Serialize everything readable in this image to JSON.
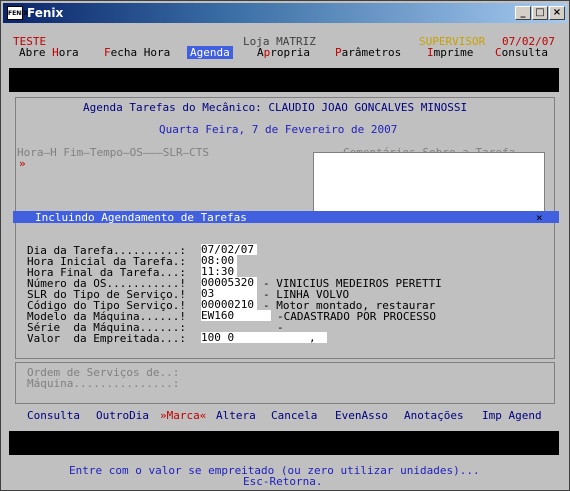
{
  "window": {
    "title": "Fenix",
    "icon_text": "FENIX"
  },
  "header": {
    "left": "TESTE",
    "center": "Loja MATRIZ",
    "user": "SUPERVISOR",
    "date": "07/02/07"
  },
  "menu": {
    "items": [
      {
        "first": "Abre ",
        "hot": "H",
        "rest": "ora"
      },
      {
        "first": "",
        "hot": "F",
        "rest": "echa Hora"
      },
      {
        "label": "Agenda"
      },
      {
        "first": "A",
        "hot": "p",
        "rest": "ropria"
      },
      {
        "first": "",
        "hot": "P",
        "rest": "arâmetros"
      },
      {
        "first": "",
        "hot": "I",
        "rest": "mprime"
      },
      {
        "first": "",
        "hot": "C",
        "rest": "onsulta"
      }
    ]
  },
  "agenda": {
    "heading": "Agenda Tarefas do Mecânico: CLAUDIO JOAO GONCALVES MINOSSI",
    "date_line": "Quarta Feira, 7 de Fevereiro de 2007",
    "columns": "Hora—H Fim—Tempo—OS———SLR—CTS",
    "comments_header": "Comentários Sobre a Tarefa",
    "row_marker": "»"
  },
  "dialog": {
    "title": "Incluindo Agendamento de Tarefas",
    "close": "×",
    "fields": [
      {
        "label": "Dia da Tarefa..........:",
        "value": "07/02/07",
        "extra": ""
      },
      {
        "label": "Hora Inicial da Tarefa.:",
        "value": "08:00",
        "extra": ""
      },
      {
        "label": "Hora Final da Tarefa...:",
        "value": "11:30",
        "extra": ""
      },
      {
        "label": "Número da OS...........!",
        "value": "00005320",
        "extra": "- VINICIUS MEDEIROS PERETTI"
      },
      {
        "label": "SLR do Tipo de Serviço.!",
        "value": "03",
        "extra": "- LINHA VOLVO"
      },
      {
        "label": "Código do Tipo Serviço.!",
        "value": "00000210",
        "extra": "- Motor montado, restaurar"
      },
      {
        "label": "Modelo da Máquina......!",
        "value": "EW160",
        "extra": "-CADASTRADO POR PROCESSO"
      },
      {
        "label": "Série  da Máquina......:",
        "value": "",
        "extra": "-"
      },
      {
        "label": "Valor  da Empreitada...:",
        "value": "100 0",
        "extra": ","
      }
    ]
  },
  "lower": {
    "ordem_label": "Ordem de Serviços de..:",
    "maquina_label": "Máquina...............:"
  },
  "bottom_menu": {
    "items": [
      "Consulta",
      "OutroDia",
      "»Marca«",
      "Altera",
      "Cancela",
      "EvenAsso",
      "Anotações",
      "Imp Agend"
    ]
  },
  "status": {
    "line1": "Entre com o valor se empreitado (ou zero utilizar unidades)...",
    "line2": "Esc-Retorna."
  }
}
